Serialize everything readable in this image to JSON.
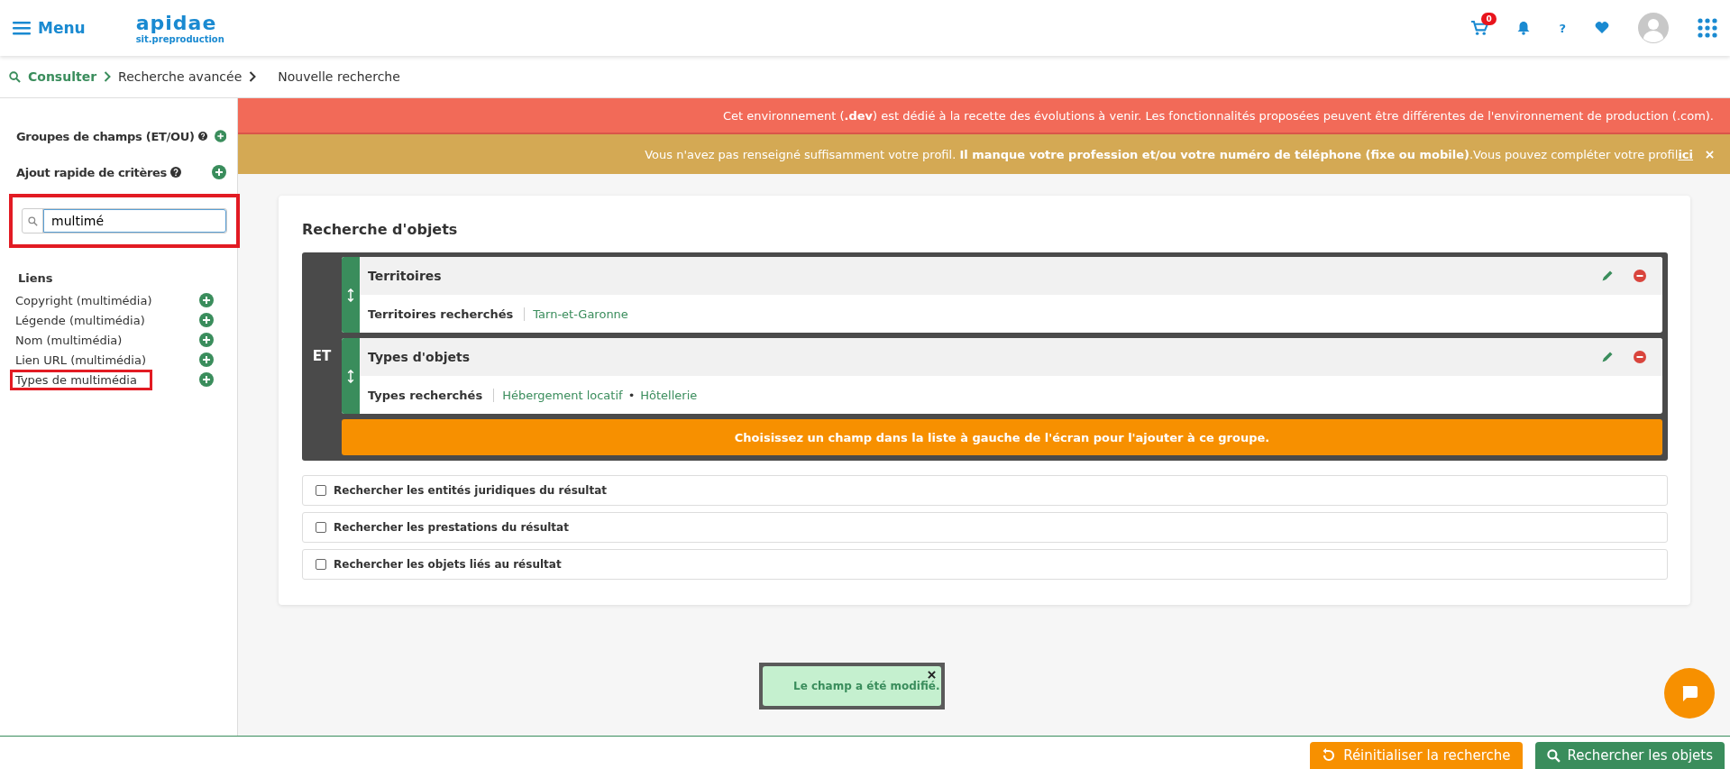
{
  "header": {
    "menu_label": "Menu",
    "logo": "apidae",
    "logo_subtitle": "sit.preproduction",
    "cart_count": "0",
    "help": "?"
  },
  "breadcrumb": [
    {
      "label": "Consulter",
      "kind": "link"
    },
    {
      "label": "Recherche avancée",
      "kind": "link"
    },
    {
      "label": "Nouvelle recherche",
      "kind": "current"
    }
  ],
  "sidebar": {
    "sections": [
      {
        "label": "Groupes de champs (ET/OU)"
      },
      {
        "label": "Ajout rapide de critères"
      }
    ],
    "search": {
      "value": "multimé",
      "highlighted": true
    },
    "group_title": "Liens",
    "items": [
      {
        "label": "Copyright (multimédia)",
        "highlighted": false
      },
      {
        "label": "Légende (multimédia)",
        "highlighted": false
      },
      {
        "label": "Nom (multimédia)",
        "highlighted": false
      },
      {
        "label": "Lien URL (multimédia)",
        "highlighted": false
      },
      {
        "label": "Types de multimédia",
        "highlighted": true
      }
    ]
  },
  "banners": [
    {
      "kind": "error",
      "text": "Cet environnement (**.dev**) est dédié à la recette des évolutions à venir. Les fonctionnalités proposées peuvent être différentes de l'environnement de production (.com).",
      "closable": false
    },
    {
      "kind": "warning",
      "text": "Vous n'avez pas renseigné suffisamment votre profil. **Il manque votre profession et/ou votre numéro de téléphone (fixe ou mobile)**.Vous pouvez compléter votre profil",
      "link": "ici",
      "closable": true
    }
  ],
  "card": {
    "title": "Recherche d'objets",
    "operator": "ET",
    "criteria": [
      {
        "title": "Territoires",
        "label": "Territoires recherchés",
        "values": [
          "Tarn-et-Garonne"
        ]
      },
      {
        "title": "Types d'objets",
        "label": "Types recherchés",
        "separator": "•",
        "values": [
          "Hébergement locatif",
          "Hôtellerie"
        ]
      }
    ],
    "hint": "Choisissez un champ dans la liste à gauche de l'écran pour l'ajouter à ce groupe.",
    "options": [
      {
        "label": "Rechercher les entités juridiques du résultat",
        "checked": false
      },
      {
        "label": "Rechercher les prestations du résultat",
        "checked": false
      },
      {
        "label": "Rechercher les objets liés au résultat",
        "checked": false
      }
    ]
  },
  "toast": {
    "message": "Le champ a été modifié."
  },
  "actions": [
    {
      "label": "Réinitialiser la recherche",
      "kind": "reset"
    },
    {
      "label": "Rechercher les objets",
      "kind": "search"
    }
  ]
}
